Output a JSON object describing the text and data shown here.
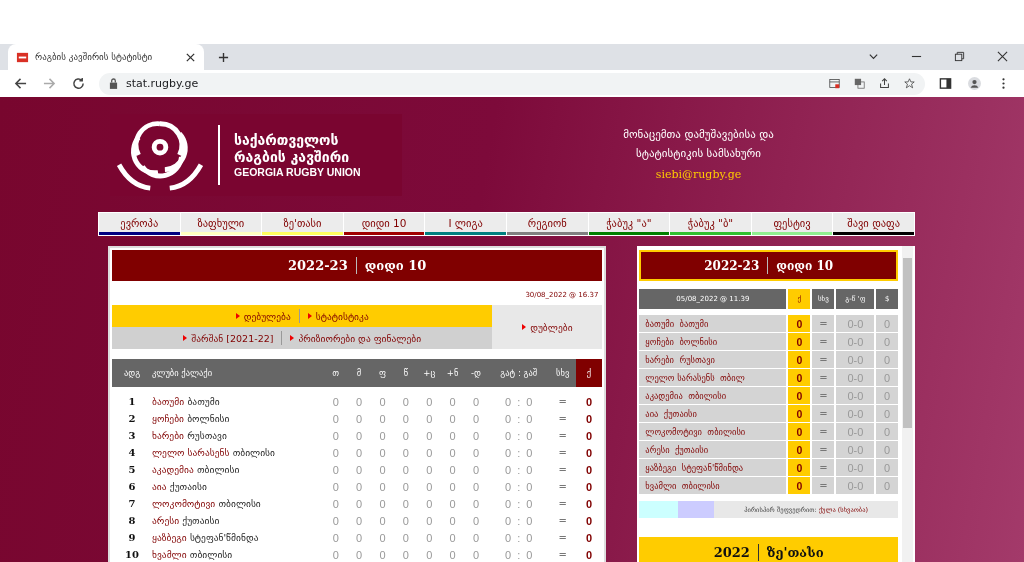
{
  "browser": {
    "tab_title": "რაგბის კავშირის სტატისტი",
    "url": "stat.rugby.ge"
  },
  "header": {
    "logo_line_1": "საქართველოს",
    "logo_line_2": "რაგბის კავშირი",
    "logo_line_3": "GEORGIA RUGBY UNION",
    "department_line_1": "მონაცემთა დამუშავებისა და",
    "department_line_2": "სტატისტიკის სამსახური",
    "email": "siebi@rugby.ge"
  },
  "nav": [
    {
      "label": "ევროპა",
      "color": "#000080"
    },
    {
      "label": "ზაფხული",
      "color": "#ffffc0"
    },
    {
      "label": "ზე'თასი",
      "color": "#ffff60"
    },
    {
      "label": "დიდი 10",
      "color": "#a00000"
    },
    {
      "label": "I ლიგა",
      "color": "#008080"
    },
    {
      "label": "რეგიონ",
      "color": "#808080"
    },
    {
      "label": "ჭაბუკ \"ა\"",
      "color": "#008000"
    },
    {
      "label": "ჭაბუკ \"ბ\"",
      "color": "#30c030"
    },
    {
      "label": "ფესტივ",
      "color": "#90ee90"
    },
    {
      "label": "შავი დაფა",
      "color": "#000000"
    }
  ],
  "standings": {
    "season": "2022-23",
    "competition": "დიდი 10",
    "updated": "30/08_2022 @ 16.37",
    "links_top": [
      "დებულება",
      "სტატისტიკა"
    ],
    "links_bottom": [
      "შარშან [2021-22]",
      "პრიზიორები და ფინალები"
    ],
    "link_side": "დუბლები",
    "columns": [
      "ადგ",
      "კლუბი",
      "ქალაქი",
      "თ",
      "მ",
      "ფ",
      "წ",
      "+ც",
      "+ნ",
      "-დ",
      "გატ : გაშ",
      "სხვ",
      "ქ"
    ],
    "rows": [
      {
        "rank": "1",
        "club": "ბათუმი",
        "city": "ბათუმი",
        "stats": [
          "0",
          "0",
          "0",
          "0",
          "0",
          "0",
          "0"
        ],
        "for": "0",
        "separator": ":",
        "against": "0",
        "diff": "=",
        "points": "0"
      },
      {
        "rank": "2",
        "club": "ყოჩები",
        "city": "ბოლნისი",
        "stats": [
          "0",
          "0",
          "0",
          "0",
          "0",
          "0",
          "0"
        ],
        "for": "0",
        "separator": ":",
        "against": "0",
        "diff": "=",
        "points": "0"
      },
      {
        "rank": "3",
        "club": "ხარები",
        "city": "რუსთავი",
        "stats": [
          "0",
          "0",
          "0",
          "0",
          "0",
          "0",
          "0"
        ],
        "for": "0",
        "separator": ":",
        "against": "0",
        "diff": "=",
        "points": "0"
      },
      {
        "rank": "4",
        "club": "ლელო სარასენს",
        "city": "თბილისი",
        "stats": [
          "0",
          "0",
          "0",
          "0",
          "0",
          "0",
          "0"
        ],
        "for": "0",
        "separator": ":",
        "against": "0",
        "diff": "=",
        "points": "0"
      },
      {
        "rank": "5",
        "club": "აკადემია",
        "city": "თბილისი",
        "stats": [
          "0",
          "0",
          "0",
          "0",
          "0",
          "0",
          "0"
        ],
        "for": "0",
        "separator": ":",
        "against": "0",
        "diff": "=",
        "points": "0"
      },
      {
        "rank": "6",
        "club": "აია",
        "city": "ქუთაისი",
        "stats": [
          "0",
          "0",
          "0",
          "0",
          "0",
          "0",
          "0"
        ],
        "for": "0",
        "separator": ":",
        "against": "0",
        "diff": "=",
        "points": "0"
      },
      {
        "rank": "7",
        "club": "ლოკომოტივი",
        "city": "თბილისი",
        "stats": [
          "0",
          "0",
          "0",
          "0",
          "0",
          "0",
          "0"
        ],
        "for": "0",
        "separator": ":",
        "against": "0",
        "diff": "=",
        "points": "0"
      },
      {
        "rank": "8",
        "club": "არესი",
        "city": "ქუთაისი",
        "stats": [
          "0",
          "0",
          "0",
          "0",
          "0",
          "0",
          "0"
        ],
        "for": "0",
        "separator": ":",
        "against": "0",
        "diff": "=",
        "points": "0"
      },
      {
        "rank": "9",
        "club": "ყაზბეგი",
        "city": "სტეფან'წმინდა",
        "stats": [
          "0",
          "0",
          "0",
          "0",
          "0",
          "0",
          "0"
        ],
        "for": "0",
        "separator": ":",
        "against": "0",
        "diff": "=",
        "points": "0"
      },
      {
        "rank": "10",
        "club": "ხვამლი",
        "city": "თბილისი",
        "stats": [
          "0",
          "0",
          "0",
          "0",
          "0",
          "0",
          "0"
        ],
        "for": "0",
        "separator": ":",
        "against": "0",
        "diff": "=",
        "points": "0"
      }
    ]
  },
  "head_to_head": {
    "season": "2022-23",
    "competition": "დიდი 10",
    "columns": [
      "05/08_2022 @ 11.39",
      "ქ",
      "სხვ",
      "გ-წ 'ფ",
      "$"
    ],
    "rows": [
      {
        "club": "ბათუმი",
        "city": "ბათუმი",
        "points": "0",
        "diff": "=",
        "record": "0-0",
        "extra": "0"
      },
      {
        "club": "ყოჩები",
        "city": "ბოლნისი",
        "points": "0",
        "diff": "=",
        "record": "0-0",
        "extra": "0"
      },
      {
        "club": "ხარები",
        "city": "რუსთავი",
        "points": "0",
        "diff": "=",
        "record": "0-0",
        "extra": "0"
      },
      {
        "club": "ლელო სარასენს",
        "city": "თბილ",
        "points": "0",
        "diff": "=",
        "record": "0-0",
        "extra": "0"
      },
      {
        "club": "აკადემია",
        "city": "თბილისი",
        "points": "0",
        "diff": "=",
        "record": "0-0",
        "extra": "0"
      },
      {
        "club": "აია",
        "city": "ქუთაისი",
        "points": "0",
        "diff": "=",
        "record": "0-0",
        "extra": "0"
      },
      {
        "club": "ლოკომოტივი",
        "city": "თბილისი",
        "points": "0",
        "diff": "=",
        "record": "0-0",
        "extra": "0"
      },
      {
        "club": "არესი",
        "city": "ქუთაისი",
        "points": "0",
        "diff": "=",
        "record": "0-0",
        "extra": "0"
      },
      {
        "club": "ყაზბეგი",
        "city": "სტეფან'წმინდა",
        "points": "0",
        "diff": "=",
        "record": "0-0",
        "extra": "0"
      },
      {
        "club": "ხვამლი",
        "city": "თბილისი",
        "points": "0",
        "diff": "=",
        "record": "0-0",
        "extra": "0"
      }
    ],
    "legend_label": "პირისპირ შეფვედრით:",
    "legend_value": "ქულა (სხვაობა)"
  },
  "next_panel": {
    "season": "2022",
    "competition": "ზე'თასი"
  }
}
